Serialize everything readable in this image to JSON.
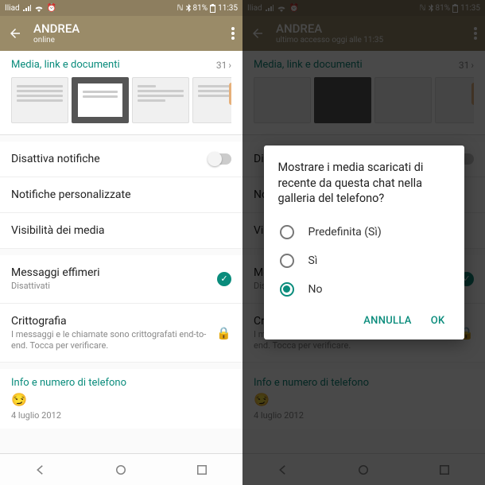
{
  "status": {
    "carrier": "Iliad",
    "battery": "81%",
    "time": "11:35"
  },
  "left": {
    "header": {
      "title": "ANDREA",
      "sub": "online"
    },
    "media": {
      "label": "Media, link e documenti",
      "count": "31"
    },
    "rows": {
      "mute": "Disattiva notifiche",
      "custom": "Notifiche personalizzate",
      "visibility": "Visibilità dei media",
      "ephemeral": "Messaggi effimeri",
      "ephemeral_sub": "Disattivati",
      "crypto": "Crittografia",
      "crypto_sub": "I messaggi e le chiamate sono crittografati end-to-end. Tocca per verificare."
    },
    "info": {
      "title": "Info e numero di telefono",
      "emoji": "😏",
      "date": "4 luglio 2012"
    }
  },
  "right": {
    "header": {
      "title": "ANDREA",
      "sub": "ultimo accesso oggi alle 11:35"
    },
    "media": {
      "label": "Media, link e documenti",
      "count": "31"
    },
    "dialog": {
      "title": "Mostrare i media scaricati di recente da questa chat nella galleria del telefono?",
      "opt_default": "Predefinita (Sì)",
      "opt_yes": "Sì",
      "opt_no": "No",
      "cancel": "ANNULLA",
      "ok": "OK"
    }
  }
}
